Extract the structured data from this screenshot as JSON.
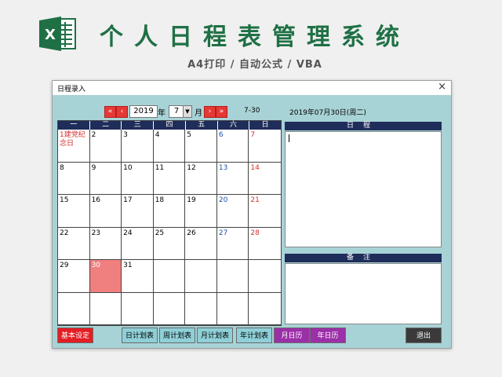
{
  "banner": {
    "title": "个人日程表管理系统",
    "subtitle": "A4打印 / 自动公式 / VBA",
    "logo_icon": "excel-icon"
  },
  "window": {
    "title": "日程录入",
    "close": "×"
  },
  "nav": {
    "prev_year": "«",
    "prev_month": "‹",
    "year": "2019",
    "year_label": "年",
    "month": "7",
    "month_label": "月",
    "next_month": "›",
    "next_year": "»",
    "range": "7-30",
    "selected_date": "2019年07月30日(周二)"
  },
  "calendar": {
    "weekdays": [
      "一",
      "二",
      "三",
      "四",
      "五",
      "六",
      "日"
    ],
    "cells": [
      {
        "text": "1建党纪念日",
        "kind": "hol"
      },
      {
        "text": "2",
        "kind": "wk"
      },
      {
        "text": "3",
        "kind": "wk"
      },
      {
        "text": "4",
        "kind": "wk"
      },
      {
        "text": "5",
        "kind": "wk"
      },
      {
        "text": "6",
        "kind": "sat"
      },
      {
        "text": "7",
        "kind": "sun"
      },
      {
        "text": "8",
        "kind": "wk"
      },
      {
        "text": "9",
        "kind": "wk"
      },
      {
        "text": "10",
        "kind": "wk"
      },
      {
        "text": "11",
        "kind": "wk"
      },
      {
        "text": "12",
        "kind": "wk"
      },
      {
        "text": "13",
        "kind": "sat"
      },
      {
        "text": "14",
        "kind": "sun"
      },
      {
        "text": "15",
        "kind": "wk"
      },
      {
        "text": "16",
        "kind": "wk"
      },
      {
        "text": "17",
        "kind": "wk"
      },
      {
        "text": "18",
        "kind": "wk"
      },
      {
        "text": "19",
        "kind": "wk"
      },
      {
        "text": "20",
        "kind": "sat"
      },
      {
        "text": "21",
        "kind": "sun"
      },
      {
        "text": "22",
        "kind": "wk"
      },
      {
        "text": "23",
        "kind": "wk"
      },
      {
        "text": "24",
        "kind": "wk"
      },
      {
        "text": "25",
        "kind": "wk"
      },
      {
        "text": "26",
        "kind": "wk"
      },
      {
        "text": "27",
        "kind": "sat"
      },
      {
        "text": "28",
        "kind": "sun"
      },
      {
        "text": "29",
        "kind": "wk"
      },
      {
        "text": "30",
        "kind": "today"
      },
      {
        "text": "31",
        "kind": "wk"
      },
      {
        "text": "",
        "kind": "wk"
      },
      {
        "text": "",
        "kind": "wk"
      },
      {
        "text": "",
        "kind": "wk"
      },
      {
        "text": "",
        "kind": "wk"
      },
      {
        "text": "",
        "kind": "wk"
      },
      {
        "text": "",
        "kind": "wk"
      },
      {
        "text": "",
        "kind": "wk"
      },
      {
        "text": "",
        "kind": "wk"
      },
      {
        "text": "",
        "kind": "wk"
      },
      {
        "text": "",
        "kind": "wk"
      },
      {
        "text": "",
        "kind": "wk"
      }
    ]
  },
  "schedule_panel": {
    "title": "日程"
  },
  "notes_panel": {
    "title": "备注"
  },
  "buttons": {
    "settings": "基本设定",
    "daily": "日计划表",
    "weekly": "周计划表",
    "monthly": "月计划表",
    "yearly": "年计划表",
    "month_cal": "月日历",
    "year_cal": "年日历",
    "exit": "退出"
  },
  "colors": {
    "title_green": "#1f7045",
    "window_bg": "#a8d3d6",
    "header_navy": "#1f2d5a",
    "today_highlight": "#f08080",
    "holiday_red": "#d32f2f",
    "saturday_blue": "#1f4fa8"
  }
}
